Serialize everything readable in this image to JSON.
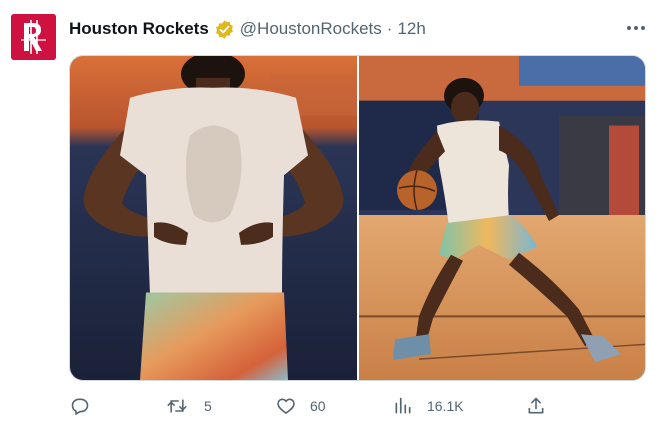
{
  "account": {
    "name": "Houston Rockets",
    "handle": "@HoustonRockets",
    "separator": "·",
    "time": "12h",
    "verified_color": "#e2b719"
  },
  "icons": {
    "avatar": "houston-rockets-logo",
    "verified": "verified-badge-icon",
    "more": "more-options-icon",
    "reply": "reply-icon",
    "retweet": "retweet-icon",
    "like": "heart-icon",
    "views": "views-icon",
    "share": "share-icon"
  },
  "media": {
    "photos": [
      {
        "description_name": "player-back-view-photo"
      },
      {
        "description_name": "player-dribbling-photo"
      }
    ]
  },
  "actions": {
    "reply_count": "",
    "retweet_count": "5",
    "like_count": "60",
    "views_count": "16.1K"
  },
  "colors": {
    "brand_red": "#ce1141",
    "muted": "#536471",
    "text": "#0f1419"
  }
}
